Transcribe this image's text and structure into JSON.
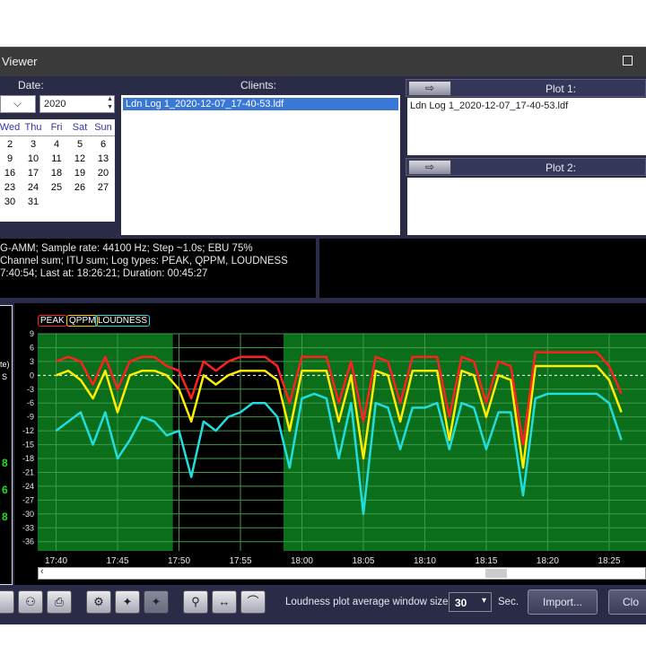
{
  "window": {
    "title": "Viewer"
  },
  "date": {
    "label": "Date:",
    "year": "2020",
    "month_value": ""
  },
  "calendar": {
    "headers": [
      "Wed",
      "Thu",
      "Fri",
      "Sat",
      "Sun"
    ],
    "rows": [
      [
        "2",
        "3",
        "4",
        "5",
        "6"
      ],
      [
        "9",
        "10",
        "11",
        "12",
        "13"
      ],
      [
        "16",
        "17",
        "18",
        "19",
        "20"
      ],
      [
        "23",
        "24",
        "25",
        "26",
        "27"
      ],
      [
        "30",
        "31",
        "",
        "",
        ""
      ]
    ]
  },
  "clients": {
    "label": "Clients:",
    "items": [
      "Ldn Log 1_2020-12-07_17-40-53.ldf"
    ]
  },
  "plot1": {
    "label": "Plot 1:",
    "items": [
      "Ldn Log 1_2020-12-07_17-40-53.ldf"
    ]
  },
  "plot2": {
    "label": "Plot 2:"
  },
  "info": {
    "line1": "G-AMM; Sample rate: 44100 Hz; Step ~1.0s; EBU 75%",
    "line2": " Channel sum; ITU sum; Log types: PEAK, QPPM, LOUDNESS",
    "line3": "7:40:54; Last at: 18:26:21; Duration: 00:45:27"
  },
  "left_values": [
    "te)",
    "S",
    "8",
    "6",
    "8"
  ],
  "chart_data": {
    "type": "line",
    "legend": [
      "PEAK",
      "QPPM",
      "LOUDNESS"
    ],
    "colors": {
      "PEAK": "#ff2020",
      "QPPM": "#ffee00",
      "LOUDNESS": "#22dddd"
    },
    "y_ticks": [
      9,
      6,
      3,
      0,
      -3,
      -6,
      -9,
      -12,
      -15,
      -18,
      -21,
      -24,
      -27,
      -30,
      -33,
      -36
    ],
    "ylim": [
      -38,
      9
    ],
    "x_ticks": [
      "17:40",
      "17:45",
      "17:50",
      "17:55",
      "18:00",
      "18:05",
      "18:10",
      "18:15",
      "18:20",
      "18:25"
    ],
    "x_minutes": [
      0,
      5,
      10,
      15,
      20,
      25,
      30,
      35,
      40,
      45
    ],
    "xlim_minutes": [
      -1.5,
      48
    ],
    "highlight_minutes": [
      9.5,
      18.5
    ],
    "x": [
      0,
      1,
      2,
      3,
      4,
      5,
      6,
      7,
      8,
      9,
      10,
      11,
      12,
      13,
      14,
      15,
      16,
      17,
      18,
      19,
      20,
      21,
      22,
      23,
      24,
      25,
      26,
      27,
      28,
      29,
      30,
      31,
      32,
      33,
      34,
      35,
      36,
      37,
      38,
      39,
      40,
      41,
      42,
      43,
      44,
      45,
      46
    ],
    "series": [
      {
        "name": "PEAK",
        "values": [
          3,
          4,
          3,
          -2,
          4,
          -3,
          3,
          4,
          4,
          2,
          1,
          -5,
          3,
          1,
          3,
          4,
          4,
          4,
          2,
          -6,
          4,
          4,
          4,
          -6,
          3,
          -10,
          4,
          3,
          -6,
          4,
          4,
          4,
          -9,
          4,
          3,
          -6,
          3,
          2,
          -15,
          5,
          5,
          5,
          5,
          5,
          5,
          2,
          -4
        ]
      },
      {
        "name": "QPPM",
        "values": [
          0,
          1,
          -1,
          -5,
          1,
          -8,
          0,
          1,
          1,
          0,
          -3,
          -10,
          0,
          -2,
          0,
          1,
          1,
          1,
          -1,
          -12,
          1,
          1,
          1,
          -10,
          0,
          -18,
          1,
          0,
          -10,
          1,
          1,
          1,
          -14,
          1,
          0,
          -9,
          0,
          -1,
          -20,
          2,
          2,
          2,
          2,
          2,
          2,
          -1,
          -8
        ]
      },
      {
        "name": "LOUDNESS",
        "values": [
          -12,
          -10,
          -8,
          -15,
          -8,
          -18,
          -14,
          -9,
          -10,
          -13,
          -12,
          -22,
          -10,
          -12,
          -9,
          -8,
          -6,
          -6,
          -9,
          -20,
          -5,
          -4,
          -5,
          -18,
          -6,
          -30,
          -6,
          -7,
          -16,
          -7,
          -7,
          -6,
          -16,
          -6,
          -7,
          -16,
          -8,
          -8,
          -26,
          -5,
          -4,
          -4,
          -4,
          -4,
          -4,
          -6,
          -14
        ]
      }
    ]
  },
  "toolbar": {
    "window_label": "Loudness plot average window size:",
    "window_value": "30",
    "unit": "Sec.",
    "import_label": "Import...",
    "close_label": "Clo"
  }
}
